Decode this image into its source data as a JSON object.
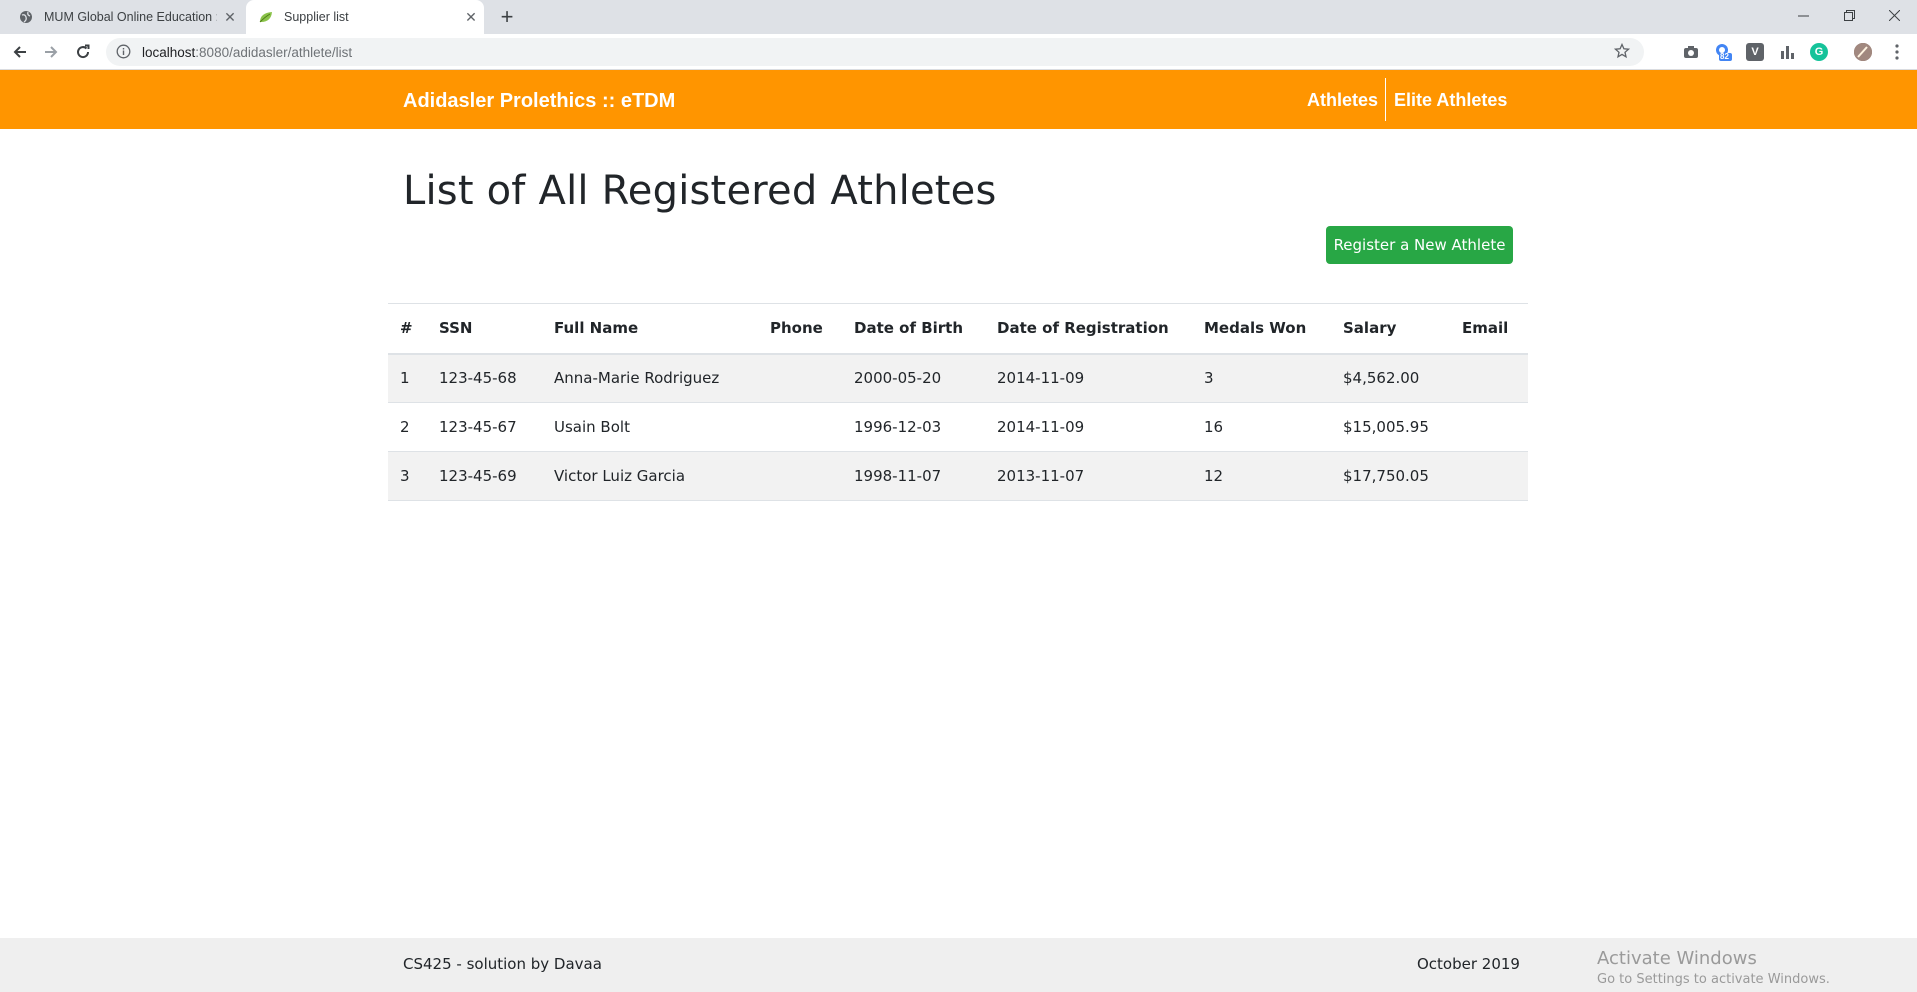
{
  "browser": {
    "tabs": [
      {
        "title": "MUM Global Online Education : C",
        "icon": "globe-icon"
      },
      {
        "title": "Supplier list",
        "icon": "leaf-icon"
      }
    ],
    "url_host": "localhost",
    "url_path": ":8080/adidasler/athlete/list",
    "extension_badge": "82"
  },
  "header": {
    "brand": "Adidasler Prolethics :: eTDM",
    "nav": [
      "Athletes",
      "Elite Athletes"
    ],
    "color": "#ff9500"
  },
  "main": {
    "title": "List of All Registered Athletes",
    "register_button": "Register a New Athlete",
    "button_color": "#28a745"
  },
  "table": {
    "columns": [
      "#",
      "SSN",
      "Full Name",
      "Phone",
      "Date of Birth",
      "Date of Registration",
      "Medals Won",
      "Salary",
      "Email"
    ],
    "rows": [
      [
        "1",
        "123-45-68",
        "Anna-Marie Rodriguez",
        "",
        "2000-05-20",
        "2014-11-09",
        "3",
        "$4,562.00",
        ""
      ],
      [
        "2",
        "123-45-67",
        "Usain Bolt",
        "",
        "1996-12-03",
        "2014-11-09",
        "16",
        "$15,005.95",
        ""
      ],
      [
        "3",
        "123-45-69",
        "Victor Luiz Garcia",
        "",
        "1998-11-07",
        "2013-11-07",
        "12",
        "$17,750.05",
        ""
      ]
    ]
  },
  "footer": {
    "left": "CS425 - solution by Davaa",
    "right": "October 2019"
  },
  "watermark": {
    "line1": "Activate Windows",
    "line2": "Go to Settings to activate Windows."
  }
}
